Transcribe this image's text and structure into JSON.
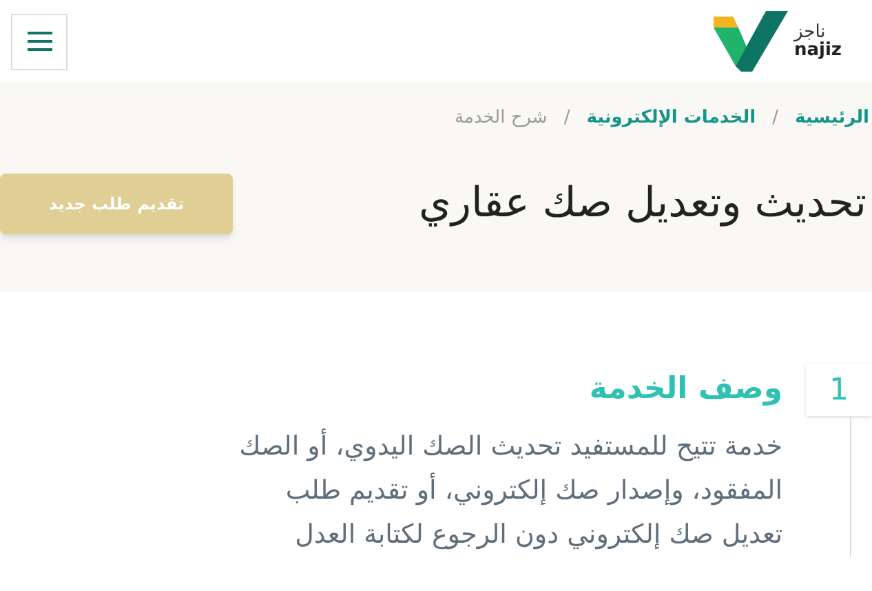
{
  "logo": {
    "arabic": "ناجز",
    "latin": "najiz"
  },
  "breadcrumb": [
    {
      "label": "الرئيسية",
      "kind": "link"
    },
    {
      "label": "الخدمات الإلكترونية",
      "kind": "link"
    },
    {
      "label": "شرح الخدمة",
      "kind": "current"
    }
  ],
  "breadcrumb_separator": "/",
  "page_title": "تحديث وتعديل صك عقاري",
  "new_request_button": "تقديم طلب جديد",
  "steps": [
    {
      "number": "1",
      "title": "وصف الخدمة",
      "description": "خدمة تتيح للمستفيد تحديث الصك اليدوي، أو الصك المفقود، وإصدار صك إلكتروني، أو تقديم طلب تعديل صك إلكتروني دون الرجوع لكتابة العدل"
    }
  ]
}
